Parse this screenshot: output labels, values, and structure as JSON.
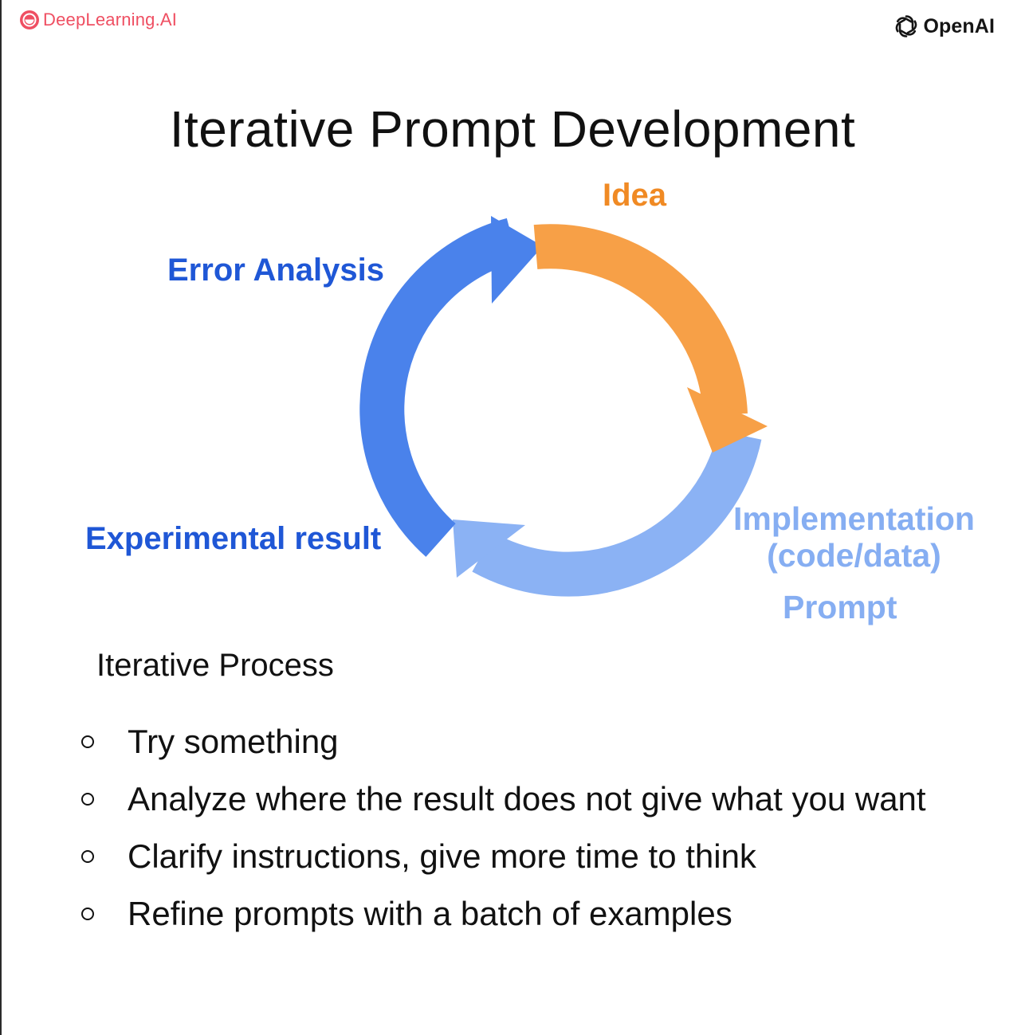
{
  "brands": {
    "deeplearning": "DeepLearning.AI",
    "openai": "OpenAI",
    "deeplearning_icon": "deeplearning-logo-icon",
    "openai_icon": "openai-logo-icon"
  },
  "title": "Iterative Prompt Development",
  "diagram": {
    "labels": {
      "idea": "Idea",
      "error_analysis": "Error Analysis",
      "experimental_result": "Experimental result",
      "implementation_line1": "Implementation",
      "implementation_line2": "(code/data)",
      "prompt": "Prompt"
    },
    "colors": {
      "idea": "#f7a047",
      "idea_text": "#f08a24",
      "error": "#4a82eb",
      "error_text": "#1f57d6",
      "implementation": "#8bb2f4",
      "implementation_text": "#86aef2"
    }
  },
  "process": {
    "heading": "Iterative Process",
    "items": [
      "Try something",
      "Analyze where the result does not give what you want",
      "Clarify instructions, give more time to think",
      "Refine prompts with a batch of examples"
    ]
  }
}
